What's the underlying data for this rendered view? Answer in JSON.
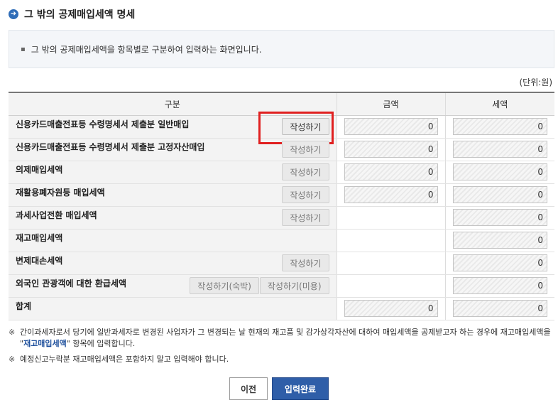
{
  "header": {
    "title": "그 밖의 공제매입세액 명세",
    "icon": "arrow-right-circle-icon"
  },
  "info": {
    "text": "그 밖의 공제매입세액을 항목별로 구분하여 입력하는 화면입니다."
  },
  "unit_label": "(단위:원)",
  "table": {
    "headers": [
      "구분",
      "금액",
      "세액"
    ],
    "rows": [
      {
        "label": "신용카드매출전표등 수령명세서 제출분 일반매입",
        "buttons": [
          "작성하기"
        ],
        "amount": "0",
        "tax": "0"
      },
      {
        "label": "신용카드매출전표등 수령명세서 제출분 고정자산매입",
        "buttons": [
          "작성하기"
        ],
        "amount": "0",
        "tax": "0"
      },
      {
        "label": "의제매입세액",
        "buttons": [
          "작성하기"
        ],
        "amount": "0",
        "tax": "0"
      },
      {
        "label": "재활용폐자원등 매입세액",
        "buttons": [
          "작성하기"
        ],
        "amount": "0",
        "tax": "0"
      },
      {
        "label": "과세사업전환 매입세액",
        "buttons": [
          "작성하기"
        ],
        "amount": null,
        "tax": "0"
      },
      {
        "label": "재고매입세액",
        "buttons": [],
        "amount": null,
        "tax": "0"
      },
      {
        "label": "변제대손세액",
        "buttons": [
          "작성하기"
        ],
        "amount": null,
        "tax": "0"
      },
      {
        "label": "외국인 관광객에 대한 환급세액",
        "buttons": [
          "작성하기(숙박)",
          "작성하기(미용)"
        ],
        "amount": null,
        "tax": "0"
      },
      {
        "label": "합계",
        "buttons": [],
        "amount": "0",
        "tax": "0"
      }
    ]
  },
  "notes": {
    "mark": "※",
    "note1_a": "간이과세자로서 당기에 일반과세자로 변경된 사업자가 그 변경되는 날 현재의 재고품 및 감가상각자산에 대하여 매입세액을 공제받고자 하는 경우에 재고매입세액을 \"",
    "note1_emph": "재고매입세액",
    "note1_b": "\" 항목에 입력합니다.",
    "note2": "예정신고누락분 재고매입세액은 포함하지 말고 입력해야 합니다."
  },
  "footer": {
    "prev_label": "이전",
    "submit_label": "입력완료"
  },
  "colors": {
    "accent": "#2f5ea8",
    "highlight": "#e02020"
  }
}
